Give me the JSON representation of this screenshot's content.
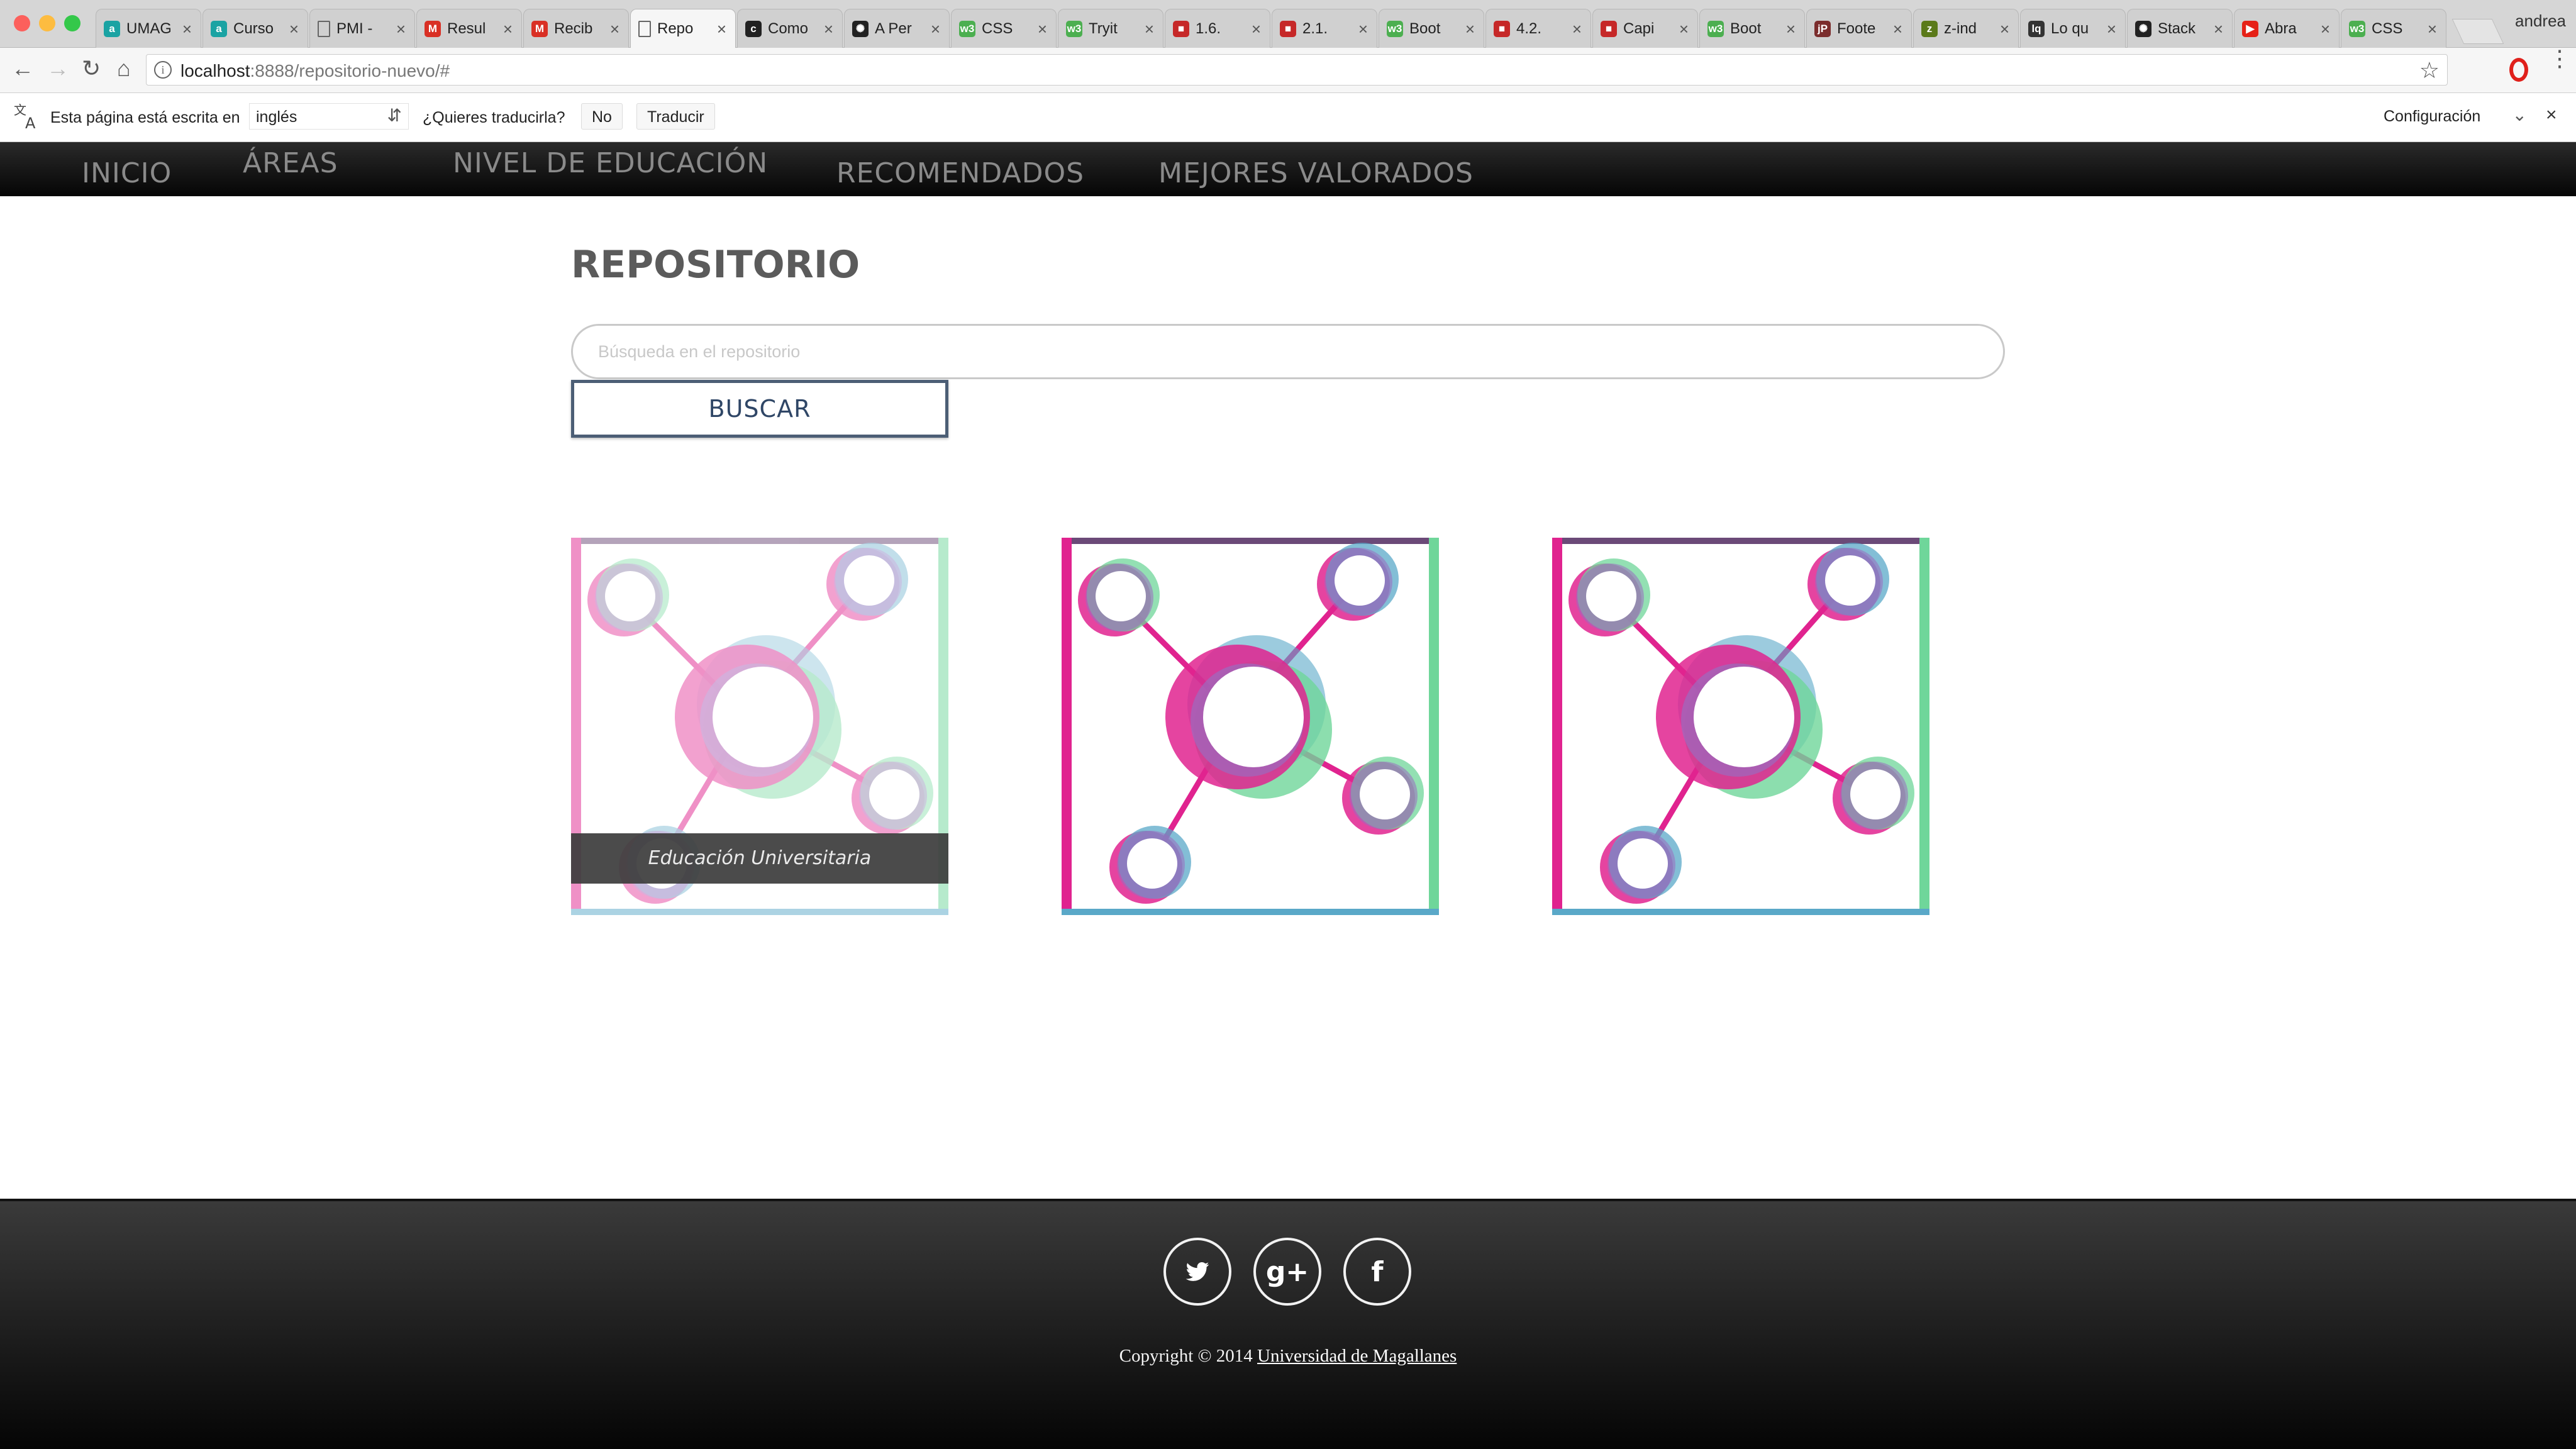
{
  "browser": {
    "tabs": [
      {
        "title": "UMAG",
        "favicon": "a",
        "color": "#1aa3a3"
      },
      {
        "title": "Curso",
        "favicon": "a",
        "color": "#1aa3a3"
      },
      {
        "title": "PMI -",
        "favicon": "doc",
        "color": "#888888"
      },
      {
        "title": "Resul",
        "favicon": "M",
        "color": "#d93025"
      },
      {
        "title": "Recib",
        "favicon": "M",
        "color": "#d93025"
      },
      {
        "title": "Repo",
        "favicon": "doc",
        "color": "#888888"
      },
      {
        "title": "Como",
        "favicon": "c",
        "color": "#222222"
      },
      {
        "title": "A Per",
        "favicon": "cp",
        "color": "#222222"
      },
      {
        "title": "CSS",
        "favicon": "w3",
        "color": "#4caf50"
      },
      {
        "title": "Tryit",
        "favicon": "w3",
        "color": "#4caf50"
      },
      {
        "title": "1.6.",
        "favicon": "bk",
        "color": "#c62828"
      },
      {
        "title": "2.1.",
        "favicon": "bk",
        "color": "#c62828"
      },
      {
        "title": "Boot",
        "favicon": "w3",
        "color": "#4caf50"
      },
      {
        "title": "4.2.",
        "favicon": "bk",
        "color": "#c62828"
      },
      {
        "title": "Capi",
        "favicon": "bk",
        "color": "#c62828"
      },
      {
        "title": "Boot",
        "favicon": "w3",
        "color": "#4caf50"
      },
      {
        "title": "Foote",
        "favicon": "jp",
        "color": "#7b2d2d"
      },
      {
        "title": "z-ind",
        "favicon": "z",
        "color": "#5b7a1a"
      },
      {
        "title": "Lo qu",
        "favicon": "lq",
        "color": "#333333"
      },
      {
        "title": "Stack",
        "favicon": "cp",
        "color": "#222222"
      },
      {
        "title": "Abra",
        "favicon": "yt",
        "color": "#e62117"
      },
      {
        "title": "CSS",
        "favicon": "w3",
        "color": "#4caf50"
      }
    ],
    "active_tab": 5,
    "profile_name": "andrea",
    "url_host": "localhost",
    "url_rest": ":8888/repositorio-nuevo/#"
  },
  "translate": {
    "prompt": "Esta página está escrita en",
    "language": "inglés",
    "question": "¿Quieres traducirla?",
    "no_label": "No",
    "translate_label": "Traducir",
    "config_label": "Configuración"
  },
  "nav": {
    "items": [
      "INICIO",
      "ÁREAS",
      "NIVEL DE EDUCACIÓN",
      "RECOMENDADOS",
      "MEJORES VALORADOS"
    ]
  },
  "page": {
    "title": "REPOSITORIO",
    "search_placeholder": "Búsqueda en el repositorio",
    "search_button": "BUSCAR"
  },
  "cards": [
    {
      "caption": "Educación Universitaria",
      "faded": true
    },
    {
      "caption": "",
      "faded": false
    },
    {
      "caption": "",
      "faded": false
    }
  ],
  "footer": {
    "social": [
      "twitter-icon",
      "google-plus-icon",
      "facebook-icon"
    ],
    "copyright_prefix": "Copyright © 2014",
    "copyright_link": "Universidad de Magallanes"
  },
  "colors": {
    "pink": "#e0238f",
    "green": "#6fd69a",
    "teal": "#5aa8c8",
    "purple": "#9b6bbf"
  }
}
